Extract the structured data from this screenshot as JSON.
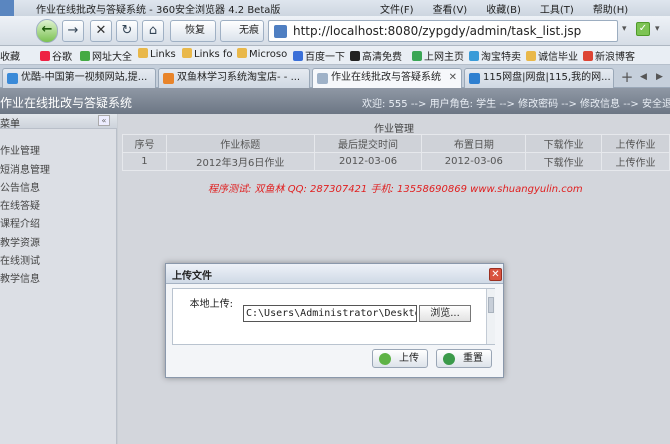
{
  "window": {
    "title": "作业在线批改与答疑系统 - 360安全浏览器 4.2 Beta版"
  },
  "menu": [
    "文件(F)",
    "查看(V)",
    "收藏(B)",
    "工具(T)",
    "帮助(H)"
  ],
  "nav": {
    "restore_label": "恢复",
    "no_state_label": "无痕",
    "address": "http://localhost:8080/zypgdy/admin/task_list.jsp"
  },
  "bookmarks": {
    "label": "收藏",
    "items": [
      "谷歌",
      "网址大全",
      "Links",
      "Links fo",
      "Microso",
      "百度一下",
      "高清免费",
      "上网主页",
      "淘宝特卖",
      "诚信毕业",
      "新浪博客"
    ]
  },
  "tabs": [
    "优酷-中国第一视频网站,提...",
    "双鱼林学习系统淘宝店- - ...",
    "作业在线批改与答疑系统",
    "115网盘|网盘|115,我的网..."
  ],
  "header": {
    "site_title": "作业在线批改与答疑系统",
    "user_bar": "欢迎: 555 --> 用户角色: 学生 --> 修改密码 --> 修改信息 --> 安全退"
  },
  "sidebar": {
    "title": "菜单",
    "items": [
      "作业管理",
      "短消息管理",
      "公告信息",
      "在线答疑",
      "课程介绍",
      "教学资源",
      "在线测试",
      "教学信息"
    ]
  },
  "content": {
    "title": "作业管理",
    "columns": [
      "序号",
      "作业标题",
      "最后提交时间",
      "布置日期",
      "下载作业",
      "上传作业"
    ],
    "rows": [
      [
        "1",
        "2012年3月6日作业",
        "2012-03-06",
        "2012-03-06",
        "下载作业",
        "上传作业"
      ]
    ],
    "promo": "程序测试: 双鱼林  QQ: 287307421  手机: 13558690869  www.shuangyulin.com"
  },
  "dialog": {
    "title": "上传文件",
    "file_label": "本地上传:",
    "file_value": "C:\\Users\\Administrator\\Desktop\\我",
    "browse_label": "浏览...",
    "upload_label": "上传",
    "reset_label": "重置"
  }
}
